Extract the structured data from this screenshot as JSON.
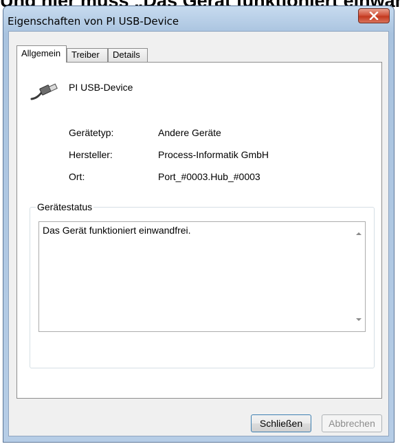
{
  "caption": "Und hier muss „Das Gerät funktioniert einwandfrei“",
  "window": {
    "title": "Eigenschaften von PI USB-Device"
  },
  "tabs": [
    {
      "label": "Allgemein",
      "active": true
    },
    {
      "label": "Treiber",
      "active": false
    },
    {
      "label": "Details",
      "active": false
    }
  ],
  "device": {
    "name": "PI USB-Device",
    "icon": "usb-plug-icon",
    "properties": [
      {
        "label": "Gerätetyp:",
        "value": "Andere Geräte"
      },
      {
        "label": "Hersteller:",
        "value": "Process-Informatik GmbH"
      },
      {
        "label": "Ort:",
        "value": "Port_#0003.Hub_#0003"
      }
    ]
  },
  "status": {
    "group_label": "Gerätestatus",
    "text": "Das Gerät funktioniert einwandfrei."
  },
  "buttons": {
    "close": "Schließen",
    "cancel": "Abbrechen"
  },
  "colors": {
    "title_bar": "#b9d1ea",
    "close_button": "#c7432b",
    "default_button_border": "#3c7fb1"
  }
}
